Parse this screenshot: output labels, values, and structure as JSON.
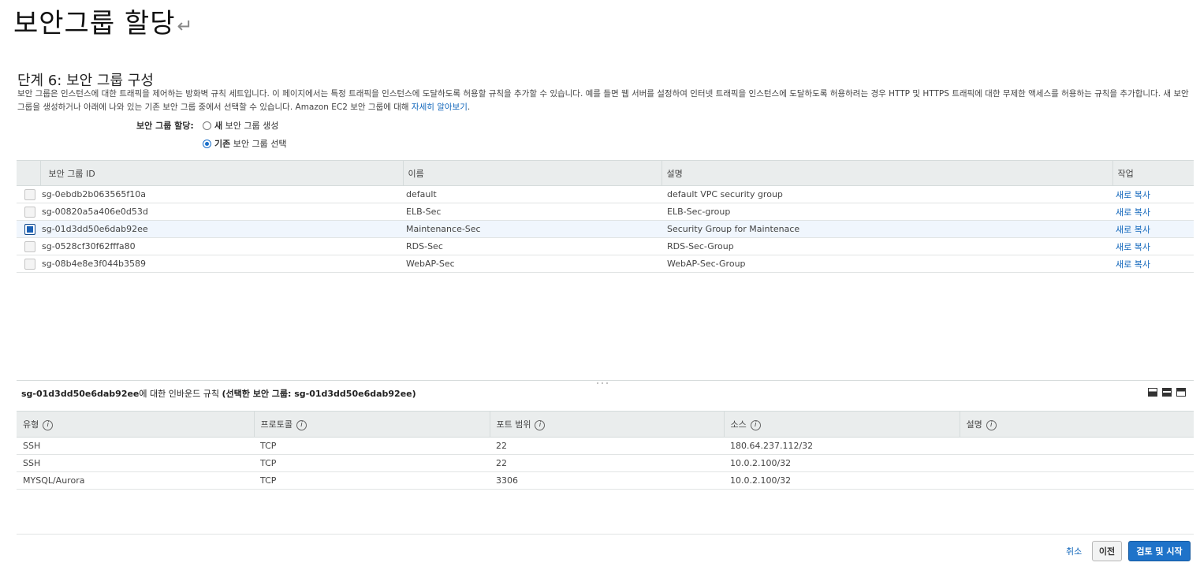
{
  "document": {
    "title": "보안그룹 할당",
    "return_mark": "↵"
  },
  "step": {
    "heading": "단계 6: 보안 그룹 구성",
    "description": "보안 그룹은 인스턴스에 대한 트래픽을 제어하는 방화벽 규칙 세트입니다. 이 페이지에서는 특정 트래픽을 인스턴스에 도달하도록 허용할 규칙을 추가할 수 있습니다. 예를 들면 웹 서버를 설정하여 인터넷 트래픽을 인스턴스에 도달하도록 허용하려는 경우 HTTP 및 HTTPS 트래픽에 대한 무제한 액세스를 허용하는 규칙을 추가합니다. 새 보안 그룹을 생성하거나 아래에 나와 있는 기존 보안 그룹 중에서 선택할 수 있습니다. Amazon EC2 보안 그룹에 대해 ",
    "learn_more": "자세히 알아보기",
    "learn_more_suffix": "."
  },
  "assign": {
    "label": "보안 그룹 할당:",
    "options": [
      {
        "bold": "새",
        "rest": " 보안 그룹 생성",
        "checked": false
      },
      {
        "bold": "기존",
        "rest": " 보안 그룹 선택",
        "checked": true
      }
    ]
  },
  "sg_table": {
    "headers": {
      "id": "보안 그룹 ID",
      "name": "이름",
      "desc": "설명",
      "action": "작업"
    },
    "rows": [
      {
        "id": "sg-0ebdb2b063565f10a",
        "name": "default",
        "desc": "default VPC security group",
        "action": "새로 복사",
        "checked": false
      },
      {
        "id": "sg-00820a5a406e0d53d",
        "name": "ELB-Sec",
        "desc": "ELB-Sec-group",
        "action": "새로 복사",
        "checked": false
      },
      {
        "id": "sg-01d3dd50e6dab92ee",
        "name": "Maintenance-Sec",
        "desc": "Security Group for Maintenace",
        "action": "새로 복사",
        "checked": true
      },
      {
        "id": "sg-0528cf30f62fffa80",
        "name": "RDS-Sec",
        "desc": "RDS-Sec-Group",
        "action": "새로 복사",
        "checked": false
      },
      {
        "id": "sg-08b4e8e3f044b3589",
        "name": "WebAP-Sec",
        "desc": "WebAP-Sec-Group",
        "action": "새로 복사",
        "checked": false
      }
    ]
  },
  "inbound": {
    "title_id": "sg-01d3dd50e6dab92ee",
    "title_mid": "에 대한 인바운드 규칙 ",
    "title_sel": "(선택한 보안 그룹: sg-01d3dd50e6dab92ee)",
    "grip": "˚˚˚",
    "headers": {
      "type": "유형",
      "protocol": "프로토콜",
      "port": "포트 범위",
      "source": "소스",
      "desc": "설명"
    },
    "info_glyph": "i",
    "rules": [
      {
        "type": "SSH",
        "protocol": "TCP",
        "port": "22",
        "source": "180.64.237.112/32",
        "desc": ""
      },
      {
        "type": "SSH",
        "protocol": "TCP",
        "port": "22",
        "source": "10.0.2.100/32",
        "desc": ""
      },
      {
        "type": "MYSQL/Aurora",
        "protocol": "TCP",
        "port": "3306",
        "source": "10.0.2.100/32",
        "desc": ""
      }
    ]
  },
  "footer": {
    "cancel": "취소",
    "prev": "이전",
    "launch": "검토 및 시작"
  },
  "colors": {
    "accent": "#1f73c9",
    "link": "#1166bb",
    "header_bg": "#eaeded",
    "selected_row": "#f0f6fd"
  }
}
